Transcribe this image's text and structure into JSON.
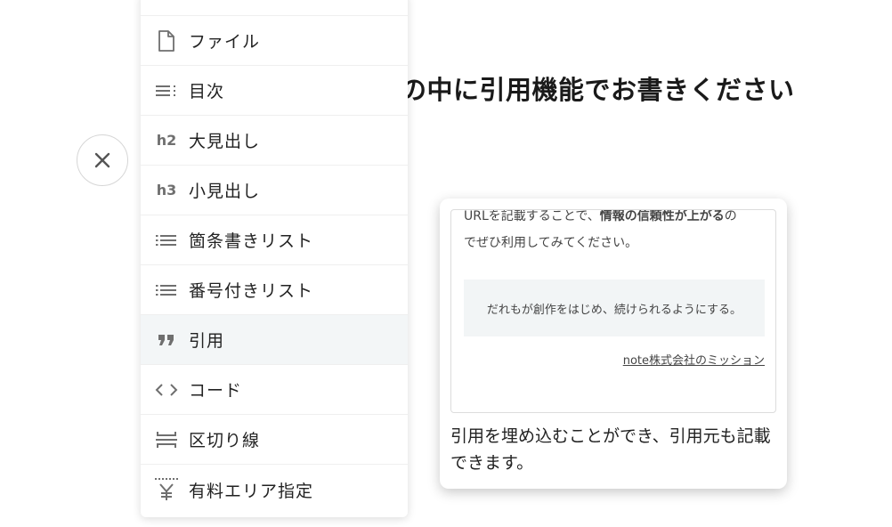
{
  "heading": "の中に引用機能でお書きください",
  "menu": {
    "items": [
      {
        "label": "ファイル",
        "icon": "file-icon"
      },
      {
        "label": "目次",
        "icon": "toc-icon"
      },
      {
        "label": "大見出し",
        "icon": "h2-icon",
        "icon_text": "h2"
      },
      {
        "label": "小見出し",
        "icon": "h3-icon",
        "icon_text": "h3"
      },
      {
        "label": "箇条書きリスト",
        "icon": "bullet-list-icon"
      },
      {
        "label": "番号付きリスト",
        "icon": "numbered-list-icon"
      },
      {
        "label": "引用",
        "icon": "quote-icon",
        "icon_text": "❞",
        "active": true
      },
      {
        "label": "コード",
        "icon": "code-icon",
        "icon_text": "<>"
      },
      {
        "label": "区切り線",
        "icon": "divider-icon"
      },
      {
        "label": "有料エリア指定",
        "icon": "paid-area-icon",
        "icon_text": "¥"
      }
    ]
  },
  "tooltip": {
    "preview_line1_plain": "URLを記載することで、",
    "preview_line1_bold": "情報の信頼性が上がる",
    "preview_line1_end": "の",
    "preview_line2": "でぜひ利用してみてください。",
    "quote_text": "だれもが創作をはじめ、続けられるようにする。",
    "quote_cite": "note株式会社のミッション",
    "description": "引用を埋め込むことができ、引用元も記載できます。"
  },
  "colors": {
    "icon": "#6f6f6f",
    "active_bg": "#f3f6f7",
    "quote_bg": "#f2f5f6"
  }
}
